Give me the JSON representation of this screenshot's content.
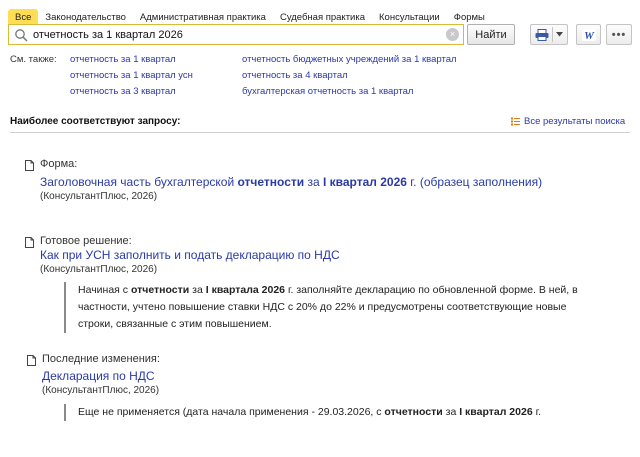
{
  "tabs": [
    "Все",
    "Законодательство",
    "Административная практика",
    "Судебная практика",
    "Консультации",
    "Формы"
  ],
  "search": {
    "value": "отчетность за 1 квартал 2026",
    "find_label": "Найти",
    "clear_glyph": "×"
  },
  "toolbar": {
    "word_label": "W",
    "more_label": "•••"
  },
  "see_also": {
    "label": "См. также:",
    "col1": [
      "отчетность за 1 квартал",
      "отчетность за 1 квартал усн",
      "отчетность за 3 квартал"
    ],
    "col2": [
      "отчетность бюджетных учреждений за 1 квартал",
      "отчетность за 4 квартал",
      "бухгалтерская отчетность за 1 квартал"
    ]
  },
  "best": {
    "header": "Наиболее соответствуют запросу:",
    "all_results": "Все результаты поиска"
  },
  "results": [
    {
      "type": "Форма:",
      "title": [
        "Заголовочная часть бухгалтерской ",
        "отчетности",
        " за ",
        "I квартал 2026",
        " г. (образец заполнения)"
      ],
      "source": "(КонсультантПлюс, 2026)"
    },
    {
      "type": "Готовое решение:",
      "title": [
        "Как при УСН заполнить и подать декларацию по НДС"
      ],
      "source": "(КонсультантПлюс, 2026)",
      "snippet": [
        "Начиная с ",
        "отчетности",
        " за ",
        "I квартала 2026",
        " г. заполняйте декларацию по обновленной форме. В ней, в частности, учтено повышение ставки НДС с 20% до 22% и предусмотрены соответствующие новые строки, связанные с этим повышением."
      ]
    },
    {
      "type": "Последние изменения:",
      "title": [
        "Декларация по НДС"
      ],
      "source": "(КонсультантПлюс, 2026)",
      "snippet": [
        "Еще не применяется (дата начала применения - 29.03.2026, с ",
        "отчетности",
        " за ",
        "I квартал 2026",
        " г."
      ]
    }
  ],
  "colors": {
    "accent_tab": "#ffdd55",
    "link": "#2a3aa8",
    "search_border": "#d9b936"
  }
}
